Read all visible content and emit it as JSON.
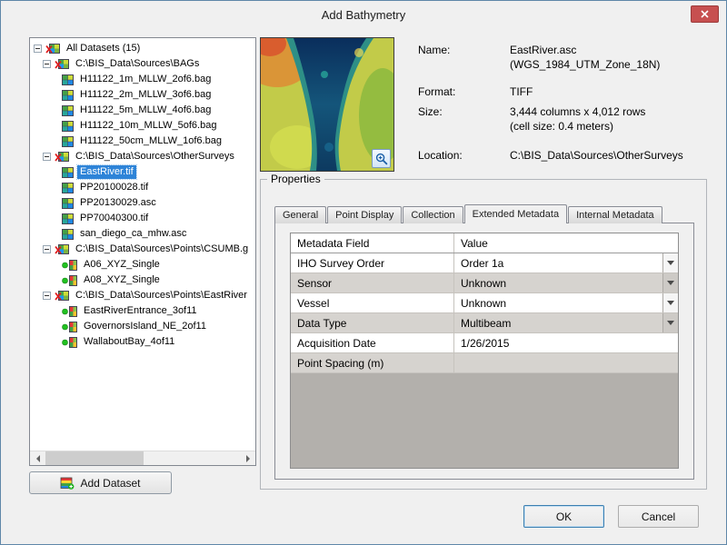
{
  "dialog": {
    "title": "Add Bathymetry"
  },
  "tree": {
    "items": [
      {
        "label": "All Datasets (15)",
        "level": 0,
        "icon": "dataset",
        "expander": true,
        "selected": false
      },
      {
        "label": "C:\\BIS_Data\\Sources\\BAGs",
        "level": 1,
        "icon": "dataset",
        "expander": true,
        "selected": false
      },
      {
        "label": "H11122_1m_MLLW_2of6.bag",
        "level": 2,
        "icon": "raster",
        "expander": false,
        "selected": false
      },
      {
        "label": "H11122_2m_MLLW_3of6.bag",
        "level": 2,
        "icon": "raster",
        "expander": false,
        "selected": false
      },
      {
        "label": "H11122_5m_MLLW_4of6.bag",
        "level": 2,
        "icon": "raster",
        "expander": false,
        "selected": false
      },
      {
        "label": "H11122_10m_MLLW_5of6.bag",
        "level": 2,
        "icon": "raster",
        "expander": false,
        "selected": false
      },
      {
        "label": "H11122_50cm_MLLW_1of6.bag",
        "level": 2,
        "icon": "raster",
        "expander": false,
        "selected": false
      },
      {
        "label": "C:\\BIS_Data\\Sources\\OtherSurveys",
        "level": 1,
        "icon": "dataset",
        "expander": true,
        "selected": false
      },
      {
        "label": "EastRiver.tif",
        "level": 2,
        "icon": "raster",
        "expander": false,
        "selected": true
      },
      {
        "label": "PP20100028.tif",
        "level": 2,
        "icon": "raster",
        "expander": false,
        "selected": false
      },
      {
        "label": "PP20130029.asc",
        "level": 2,
        "icon": "raster",
        "expander": false,
        "selected": false
      },
      {
        "label": "PP70040300.tif",
        "level": 2,
        "icon": "raster",
        "expander": false,
        "selected": false
      },
      {
        "label": "san_diego_ca_mhw.asc",
        "level": 2,
        "icon": "raster",
        "expander": false,
        "selected": false
      },
      {
        "label": "C:\\BIS_Data\\Sources\\Points\\CSUMB.g",
        "level": 1,
        "icon": "dataset",
        "expander": true,
        "selected": false
      },
      {
        "label": "A06_XYZ_Single",
        "level": 2,
        "icon": "point",
        "expander": false,
        "selected": false
      },
      {
        "label": "A08_XYZ_Single",
        "level": 2,
        "icon": "point",
        "expander": false,
        "selected": false
      },
      {
        "label": "C:\\BIS_Data\\Sources\\Points\\EastRiver",
        "level": 1,
        "icon": "dataset",
        "expander": true,
        "selected": false
      },
      {
        "label": "EastRiverEntrance_3of11",
        "level": 2,
        "icon": "point",
        "expander": false,
        "selected": false
      },
      {
        "label": "GovernorsIsland_NE_2of11",
        "level": 2,
        "icon": "point",
        "expander": false,
        "selected": false
      },
      {
        "label": "WallaboutBay_4of11",
        "level": 2,
        "icon": "point",
        "expander": false,
        "selected": false
      }
    ]
  },
  "buttons": {
    "add_dataset": "Add Dataset",
    "ok": "OK",
    "cancel": "Cancel"
  },
  "info": {
    "name_label": "Name:",
    "name_value": "EastRiver.asc",
    "name_extra": "(WGS_1984_UTM_Zone_18N)",
    "format_label": "Format:",
    "format_value": "TIFF",
    "size_label": "Size:",
    "size_value": "3,444 columns x 4,012 rows",
    "size_extra": "(cell size: 0.4 meters)",
    "location_label": "Location:",
    "location_value": "C:\\BIS_Data\\Sources\\OtherSurveys"
  },
  "properties": {
    "group_label": "Properties",
    "tabs": [
      {
        "label": "General",
        "active": false
      },
      {
        "label": "Point Display",
        "active": false
      },
      {
        "label": "Collection",
        "active": false
      },
      {
        "label": "Extended Metadata",
        "active": true
      },
      {
        "label": "Internal Metadata",
        "active": false
      }
    ],
    "table": {
      "headers": [
        "Metadata Field",
        "Value"
      ],
      "rows": [
        {
          "field": "IHO Survey Order",
          "value": "Order 1a",
          "dropdown": true,
          "shaded": false
        },
        {
          "field": "Sensor",
          "value": "Unknown",
          "dropdown": true,
          "shaded": true
        },
        {
          "field": "Vessel",
          "value": "Unknown",
          "dropdown": true,
          "shaded": false
        },
        {
          "field": "Data Type",
          "value": "Multibeam",
          "dropdown": true,
          "shaded": true
        },
        {
          "field": "Acquisition Date",
          "value": "1/26/2015",
          "dropdown": false,
          "shaded": false
        },
        {
          "field": "Point Spacing (m)",
          "value": "",
          "dropdown": false,
          "shaded": true
        }
      ]
    }
  },
  "colors": {
    "selection": "#2e84d8",
    "close_button": "#c75050",
    "dialog_border": "#5f87a8",
    "grid_shaded_row": "#d6d3cf",
    "grid_empty_area": "#b3b0ac"
  }
}
